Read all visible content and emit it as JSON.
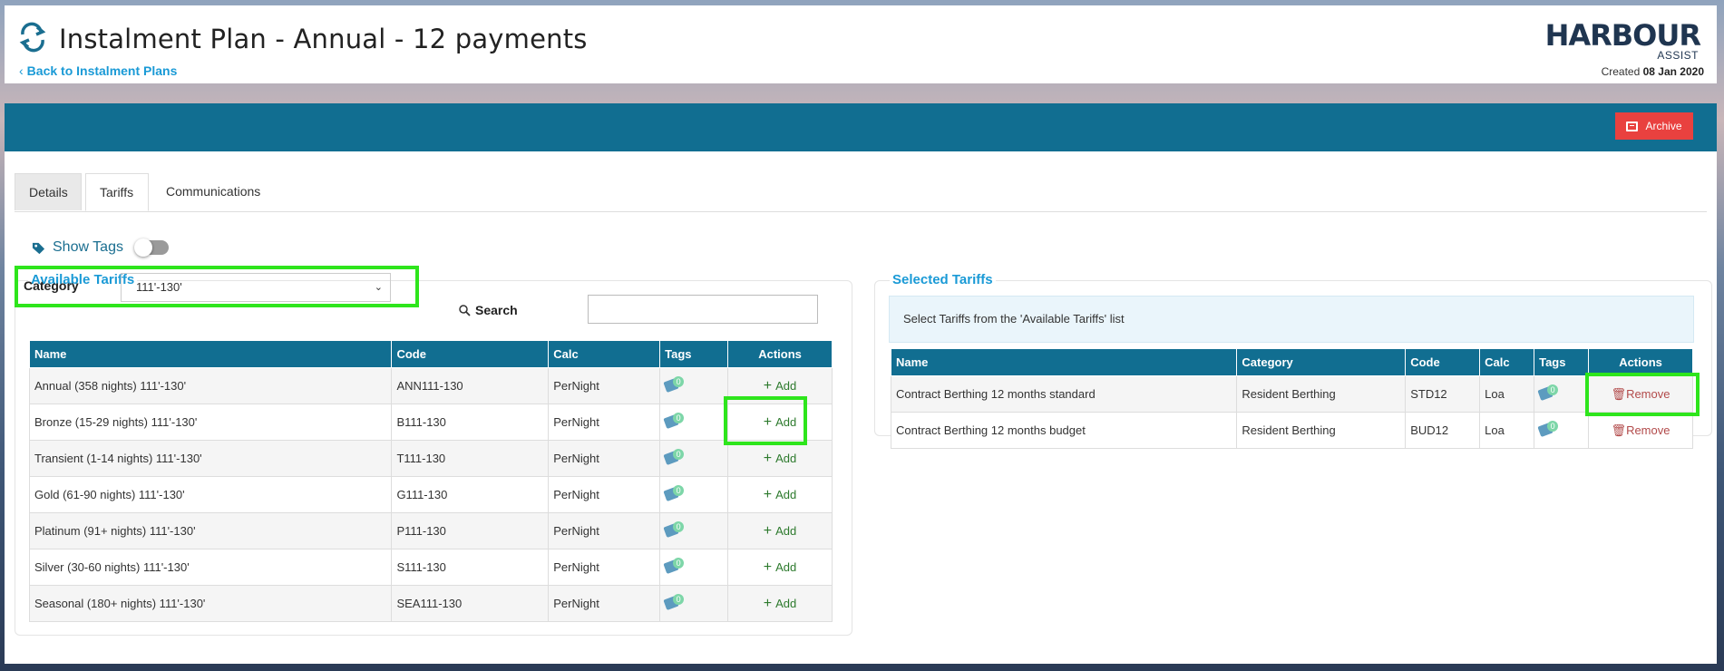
{
  "header": {
    "title": "Instalment Plan - Annual - 12 payments",
    "back_link": "Back to Instalment Plans",
    "logo_main": "HARBOUR",
    "logo_sub": "ASSIST",
    "created_label": "Created",
    "created_date": "08 Jan 2020"
  },
  "toolbar": {
    "archive_label": "Archive"
  },
  "tabs": [
    {
      "label": "Details"
    },
    {
      "label": "Tariffs"
    },
    {
      "label": "Communications"
    }
  ],
  "show_tags": {
    "label": "Show Tags",
    "enabled": false
  },
  "available": {
    "legend": "Available Tariffs",
    "category_label": "Category",
    "category_value": "111'-130'",
    "search_label": "Search",
    "columns": [
      "Name",
      "Code",
      "Calc",
      "Tags",
      "Actions"
    ],
    "rows": [
      {
        "name": "Annual (358 nights) 111'-130'",
        "code": "ANN111-130",
        "calc": "PerNight",
        "tags": "0",
        "action": "Add"
      },
      {
        "name": "Bronze (15-29 nights) 111'-130'",
        "code": "B111-130",
        "calc": "PerNight",
        "tags": "0",
        "action": "Add"
      },
      {
        "name": "Transient (1-14 nights) 111'-130'",
        "code": "T111-130",
        "calc": "PerNight",
        "tags": "0",
        "action": "Add"
      },
      {
        "name": "Gold (61-90 nights) 111'-130'",
        "code": "G111-130",
        "calc": "PerNight",
        "tags": "0",
        "action": "Add"
      },
      {
        "name": "Platinum (91+ nights) 111'-130'",
        "code": "P111-130",
        "calc": "PerNight",
        "tags": "0",
        "action": "Add"
      },
      {
        "name": "Silver (30-60 nights) 111'-130'",
        "code": "S111-130",
        "calc": "PerNight",
        "tags": "0",
        "action": "Add"
      },
      {
        "name": "Seasonal (180+ nights) 111'-130'",
        "code": "SEA111-130",
        "calc": "PerNight",
        "tags": "0",
        "action": "Add"
      }
    ]
  },
  "selected": {
    "legend": "Selected Tariffs",
    "info": "Select Tariffs from the 'Available Tariffs' list",
    "columns": [
      "Name",
      "Category",
      "Code",
      "Calc",
      "Tags",
      "Actions"
    ],
    "rows": [
      {
        "name": "Contract Berthing 12 months standard",
        "category": "Resident Berthing",
        "code": "STD12",
        "calc": "Loa",
        "tags": "0",
        "action": "Remove"
      },
      {
        "name": "Contract Berthing 12 months budget",
        "category": "Resident Berthing",
        "code": "BUD12",
        "calc": "Loa",
        "tags": "0",
        "action": "Remove"
      }
    ]
  },
  "colors": {
    "accent": "#116e91",
    "link": "#1a9ad6",
    "archive": "#e9413f",
    "highlight": "#2ee51c"
  },
  "icons": {
    "title": "refresh-icon",
    "tag": "tag-icon",
    "search": "search-icon",
    "archive": "archive-icon",
    "remove": "trash-icon"
  }
}
